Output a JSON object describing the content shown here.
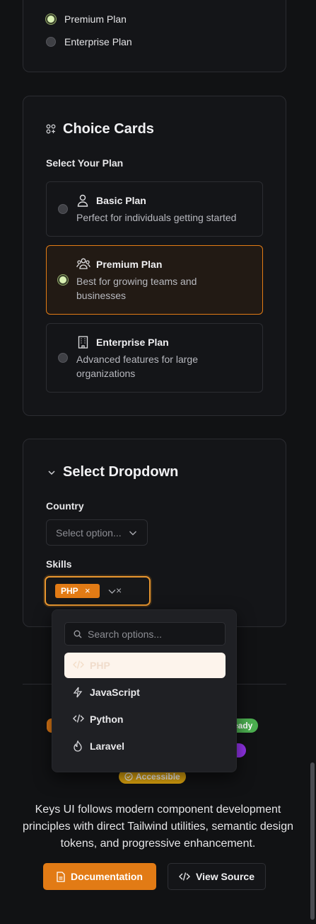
{
  "radio_group": {
    "options": [
      "Premium Plan",
      "Enterprise Plan"
    ],
    "selected": "Premium Plan"
  },
  "choice_cards": {
    "title": "Choice Cards",
    "label": "Select Your Plan",
    "plans": [
      {
        "title": "Basic Plan",
        "desc": "Perfect for individuals getting started",
        "icon": "user-icon",
        "selected": false
      },
      {
        "title": "Premium Plan",
        "desc": "Best for growing teams and businesses",
        "icon": "users-icon",
        "selected": true
      },
      {
        "title": "Enterprise Plan",
        "desc": "Advanced features for large organizations",
        "icon": "building-icon",
        "selected": false
      }
    ]
  },
  "select_dropdown": {
    "title": "Select Dropdown",
    "country_label": "Country",
    "country_placeholder": "Select option...",
    "skills_label": "Skills",
    "selected_tag": "PHP",
    "search_placeholder": "Search options...",
    "options": [
      {
        "label": "PHP",
        "icon": "code-icon",
        "selected": true
      },
      {
        "label": "JavaScript",
        "icon": "bolt-icon",
        "selected": false
      },
      {
        "label": "Python",
        "icon": "code-icon",
        "selected": false
      },
      {
        "label": "Laravel",
        "icon": "flame-icon",
        "selected": false
      }
    ]
  },
  "badges": {
    "ready_fragment": "eady",
    "accessible": "Accessible"
  },
  "footer": {
    "description": "Keys UI follows modern component development principles with direct Tailwind utilities, semantic design tokens, and progressive enhancement.",
    "docs_button": "Documentation",
    "source_button": "View Source"
  },
  "colors": {
    "accent": "#e27b15",
    "green": "#4caf50",
    "purple": "#9333ea",
    "yellow": "#e1a70f"
  }
}
